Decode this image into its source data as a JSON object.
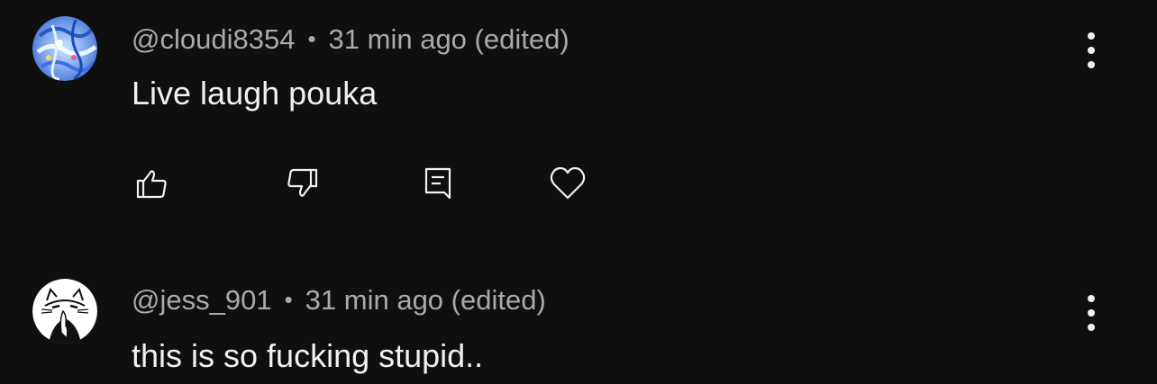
{
  "comments": [
    {
      "author": "@cloudi8354",
      "separator": "•",
      "time": "31 min ago (edited)",
      "text": "Live laugh pouka",
      "avatar_icon": "abstract-blue-avatar-icon",
      "actions": [
        "like-icon",
        "dislike-icon",
        "reply-icon",
        "heart-icon"
      ]
    },
    {
      "author": "@jess_901",
      "separator": "•",
      "time": "31 min ago (edited)",
      "text": "this is so fucking stupid..",
      "avatar_icon": "cat-drawing-avatar-icon"
    }
  ],
  "colors": {
    "background": "#0f0f0f",
    "primary_text": "#f1f1f1",
    "secondary_text": "#aaaaaa"
  }
}
